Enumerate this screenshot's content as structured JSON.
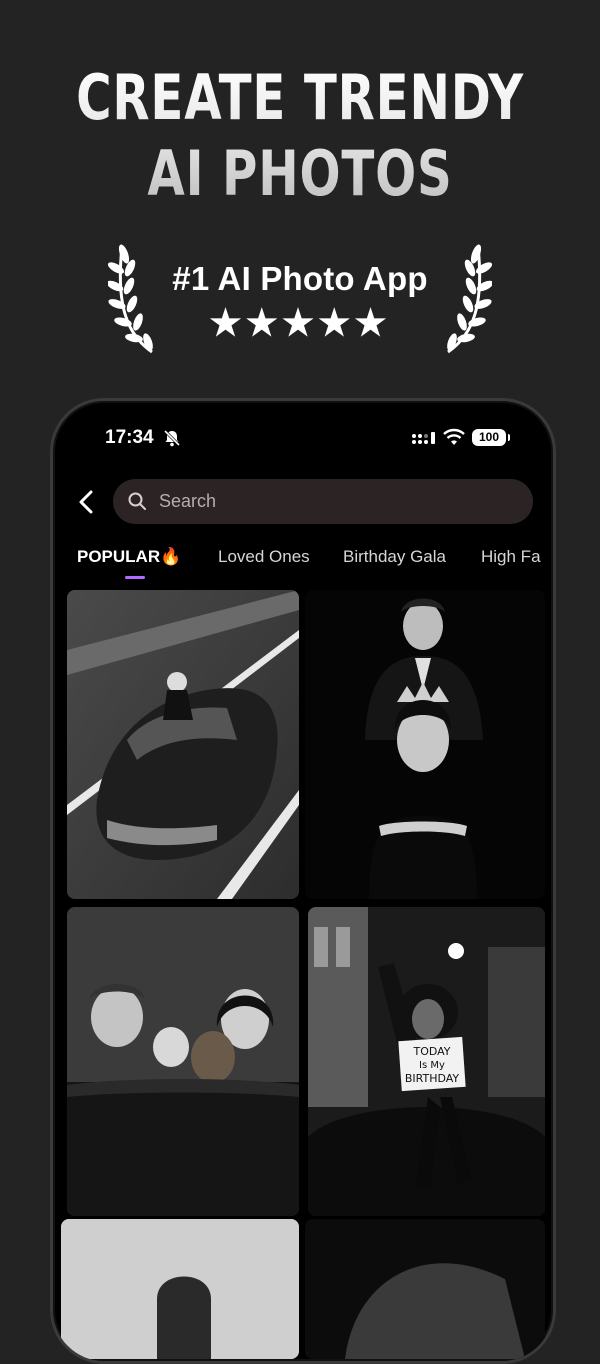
{
  "promo": {
    "headline_line1": "CREATE TRENDY",
    "headline_line2": "AI PHOTOS",
    "badge_title": "#1 AI Photo App",
    "rating_stars": "★★★★★",
    "rating_value": 5
  },
  "status_bar": {
    "time": "17:34",
    "battery": "100"
  },
  "search": {
    "placeholder": "Search"
  },
  "tabs": [
    {
      "label": "POPULAR🔥",
      "active": true
    },
    {
      "label": "Loved Ones",
      "active": false
    },
    {
      "label": "Birthday Gala",
      "active": false
    },
    {
      "label": "High Fa",
      "active": false
    }
  ],
  "gallery": [
    {
      "image": "woman-standing-in-car-sunroof"
    },
    {
      "image": "man-placing-crown-on-woman"
    },
    {
      "image": "family-with-baby-and-dog"
    },
    {
      "image": "woman-holding-birthday-sign"
    },
    {
      "image": "portrait-partial-left"
    },
    {
      "image": "portrait-partial-right"
    }
  ],
  "birthday_sign": {
    "line1": "TODAY",
    "line2": "Is My",
    "line3": "BIRTHDAY"
  },
  "colors": {
    "background": "#232323",
    "phone_screen": "#000000",
    "search_bg": "#2c2325",
    "tab_accent": "#b06cff"
  }
}
